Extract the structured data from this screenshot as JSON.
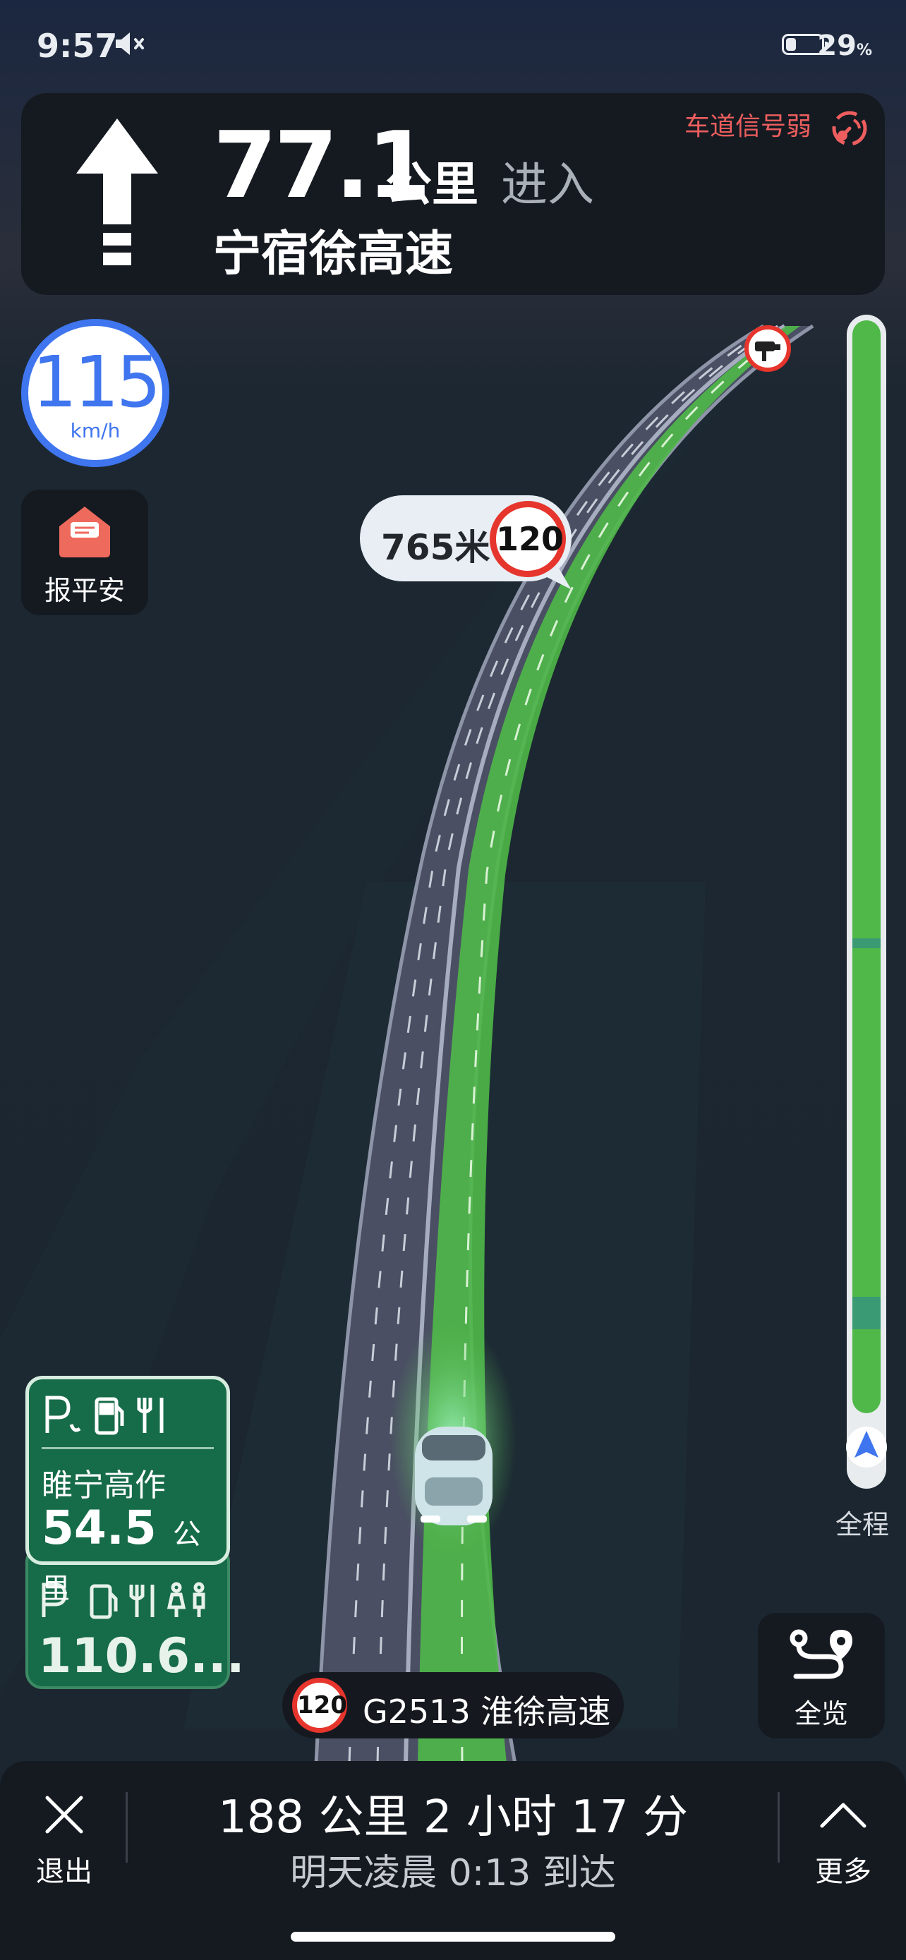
{
  "status_bar": {
    "time": "9:57",
    "battery_percent": "29",
    "battery_unit": "%",
    "battery_level": 0.29
  },
  "guidance": {
    "distance": "77.1",
    "distance_unit": "公里",
    "action": "进入",
    "road_name": "宁宿徐高速",
    "signal_warning": "车道信号弱",
    "icon": "straight-arrow-icon"
  },
  "speed": {
    "value": "115",
    "unit": "km/h"
  },
  "report_safe": {
    "label": "报平安",
    "icon": "envelope-icon"
  },
  "camera": {
    "distance": "765米",
    "limit": "120",
    "icon": "speed-camera-icon"
  },
  "progress": {
    "label": "全程",
    "traveled": 0.06
  },
  "service_areas": [
    {
      "name": "睢宁高作",
      "distance": "54.5",
      "unit": "公里",
      "facilities": [
        "parking-icon",
        "fuel-icon",
        "restaurant-icon"
      ]
    },
    {
      "distance": "110.6...",
      "facilities": [
        "parking-icon",
        "fuel-icon",
        "restaurant-icon",
        "toilet-icon"
      ]
    }
  ],
  "overview": {
    "label": "全览",
    "icon": "route-overview-icon"
  },
  "current_road": {
    "limit": "120",
    "name": "G2513 淮徐高速"
  },
  "bottom": {
    "exit_label": "退出",
    "trip_summary": "188 公里  2 小时 17 分",
    "eta": "明天凌晨 0:13 到达",
    "more_label": "更多"
  },
  "colors": {
    "route": "#4fb848",
    "speed_ring": "#3f75ee",
    "warning": "#ee5e5e",
    "service_green": "#166b48",
    "panel": "#151a21"
  }
}
